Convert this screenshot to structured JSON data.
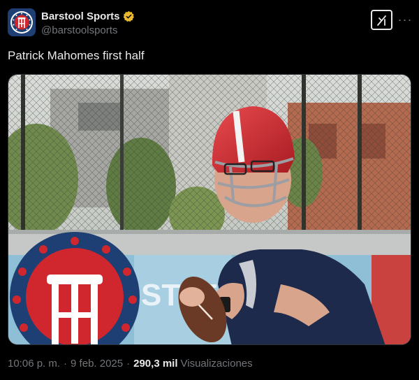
{
  "author": {
    "display_name": "Barstool Sports",
    "handle": "@barstoolsports",
    "verified_color": "#e8b830"
  },
  "tweet": {
    "text": "Patrick Mahomes first half"
  },
  "media": {
    "description_icon": "photo",
    "banner_text": "STATE"
  },
  "meta": {
    "time": "10:06 p. m.",
    "separator": "·",
    "date": "9 feb. 2025",
    "views_count": "290,3 mil",
    "views_label": "Visualizaciones"
  },
  "colors": {
    "background": "#000000",
    "text_primary": "#e7e9ea",
    "text_secondary": "#71767b",
    "brand_red": "#d0262e",
    "brand_navy": "#1d3f73"
  }
}
